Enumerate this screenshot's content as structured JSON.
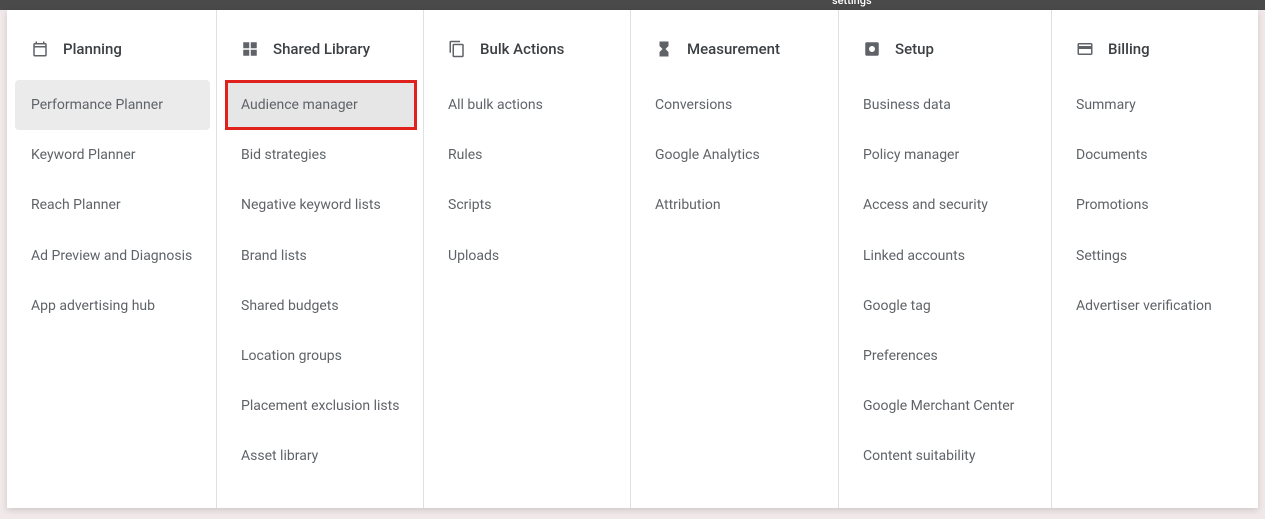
{
  "topbar": {
    "partial": "settings"
  },
  "columns": [
    {
      "header": "Planning",
      "icon": "calendar-icon",
      "items": [
        {
          "label": "Performance Planner",
          "selected": true
        },
        {
          "label": "Keyword Planner"
        },
        {
          "label": "Reach Planner"
        },
        {
          "label": "Ad Preview and Diagnosis"
        },
        {
          "label": "App advertising hub"
        }
      ]
    },
    {
      "header": "Shared Library",
      "icon": "grid-icon",
      "items": [
        {
          "label": "Audience manager",
          "highlight": true
        },
        {
          "label": "Bid strategies"
        },
        {
          "label": "Negative keyword lists"
        },
        {
          "label": "Brand lists"
        },
        {
          "label": "Shared budgets"
        },
        {
          "label": "Location groups"
        },
        {
          "label": "Placement exclusion lists"
        },
        {
          "label": "Asset library"
        }
      ]
    },
    {
      "header": "Bulk Actions",
      "icon": "copy-icon",
      "items": [
        {
          "label": "All bulk actions"
        },
        {
          "label": "Rules"
        },
        {
          "label": "Scripts"
        },
        {
          "label": "Uploads"
        }
      ]
    },
    {
      "header": "Measurement",
      "icon": "hourglass-icon",
      "items": [
        {
          "label": "Conversions"
        },
        {
          "label": "Google Analytics"
        },
        {
          "label": "Attribution"
        }
      ]
    },
    {
      "header": "Setup",
      "icon": "gear-box-icon",
      "items": [
        {
          "label": "Business data"
        },
        {
          "label": "Policy manager"
        },
        {
          "label": "Access and security"
        },
        {
          "label": "Linked accounts"
        },
        {
          "label": "Google tag"
        },
        {
          "label": "Preferences"
        },
        {
          "label": "Google Merchant Center"
        },
        {
          "label": "Content suitability"
        }
      ]
    },
    {
      "header": "Billing",
      "icon": "card-icon",
      "items": [
        {
          "label": "Summary"
        },
        {
          "label": "Documents"
        },
        {
          "label": "Promotions"
        },
        {
          "label": "Settings"
        },
        {
          "label": "Advertiser verification"
        }
      ]
    }
  ]
}
